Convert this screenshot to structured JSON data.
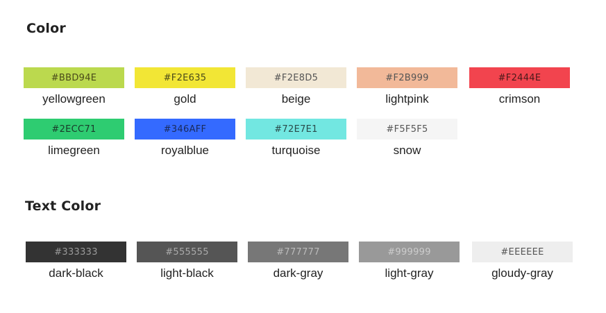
{
  "color_section": {
    "title": "Color",
    "swatches": [
      {
        "hex": "#BBD94E",
        "name": "yellowgreen",
        "bg": "#BBD94E",
        "fg": "#4a4a1a"
      },
      {
        "hex": "#F2E635",
        "name": "gold",
        "bg": "#F2E635",
        "fg": "#4a4a1a"
      },
      {
        "hex": "#F2E8D5",
        "name": "beige",
        "bg": "#F2E8D5",
        "fg": "#555555"
      },
      {
        "hex": "#F2B999",
        "name": "lightpink",
        "bg": "#F2B999",
        "fg": "#555555"
      },
      {
        "hex": "#F2444E",
        "name": "crimson",
        "bg": "#F2444E",
        "fg": "#4a1a1a"
      },
      {
        "hex": "#2ECC71",
        "name": "limegreen",
        "bg": "#2ECC71",
        "fg": "#1a3a2a"
      },
      {
        "hex": "#346AFF",
        "name": "royalblue",
        "bg": "#346AFF",
        "fg": "#1a2a5a"
      },
      {
        "hex": "#72E7E1",
        "name": "turquoise",
        "bg": "#72E7E1",
        "fg": "#2a4a4a"
      },
      {
        "hex": "#F5F5F5",
        "name": "snow",
        "bg": "#F5F5F5",
        "fg": "#555555"
      }
    ]
  },
  "text_color_section": {
    "title": "Text Color",
    "swatches": [
      {
        "hex": "#333333",
        "name": "dark-black",
        "bg": "#333333",
        "fg": "#9a9a9a"
      },
      {
        "hex": "#555555",
        "name": "light-black",
        "bg": "#555555",
        "fg": "#aaaaaa"
      },
      {
        "hex": "#777777",
        "name": "dark-gray",
        "bg": "#777777",
        "fg": "#bbbbbb"
      },
      {
        "hex": "#999999",
        "name": "light-gray",
        "bg": "#999999",
        "fg": "#cccccc"
      },
      {
        "hex": "#EEEEEE",
        "name": "gloudy-gray",
        "bg": "#EEEEEE",
        "fg": "#555555"
      }
    ]
  }
}
